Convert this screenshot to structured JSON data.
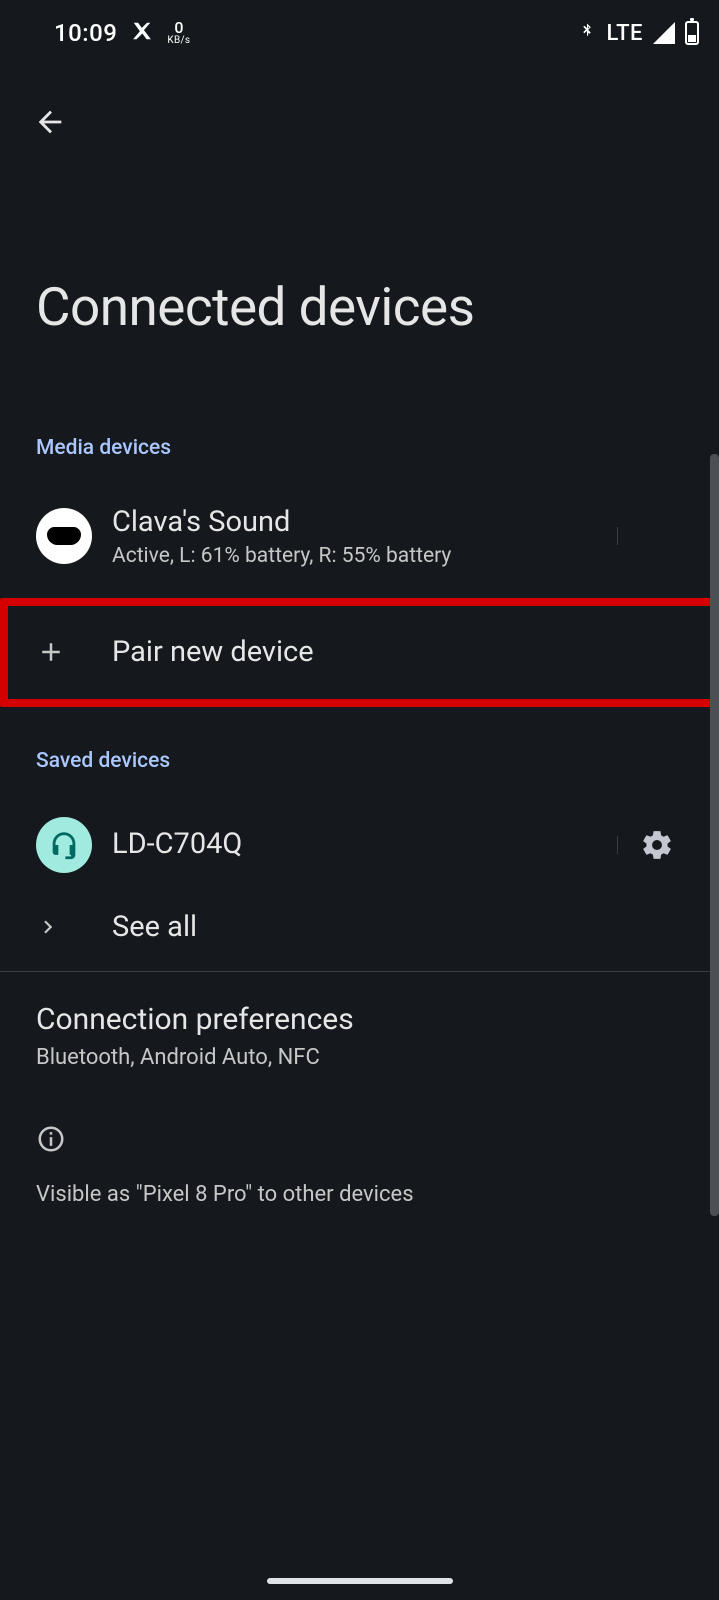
{
  "status": {
    "time": "10:09",
    "kbs_value": "0",
    "kbs_unit": "KB/s",
    "network_label": "LTE"
  },
  "header": {
    "title": "Connected devices"
  },
  "sections": {
    "media_label": "Media devices",
    "saved_label": "Saved devices"
  },
  "media_device": {
    "name": "Clava's Sound",
    "status": "Active, L: 61% battery, R: 55% battery"
  },
  "actions": {
    "pair_label": "Pair new device",
    "see_all_label": "See all"
  },
  "saved_device": {
    "name": "LD-C704Q"
  },
  "prefs": {
    "title": "Connection preferences",
    "sub": "Bluetooth, Android Auto, NFC"
  },
  "footer": {
    "visible_text": "Visible as \"Pixel 8 Pro\" to other devices"
  }
}
